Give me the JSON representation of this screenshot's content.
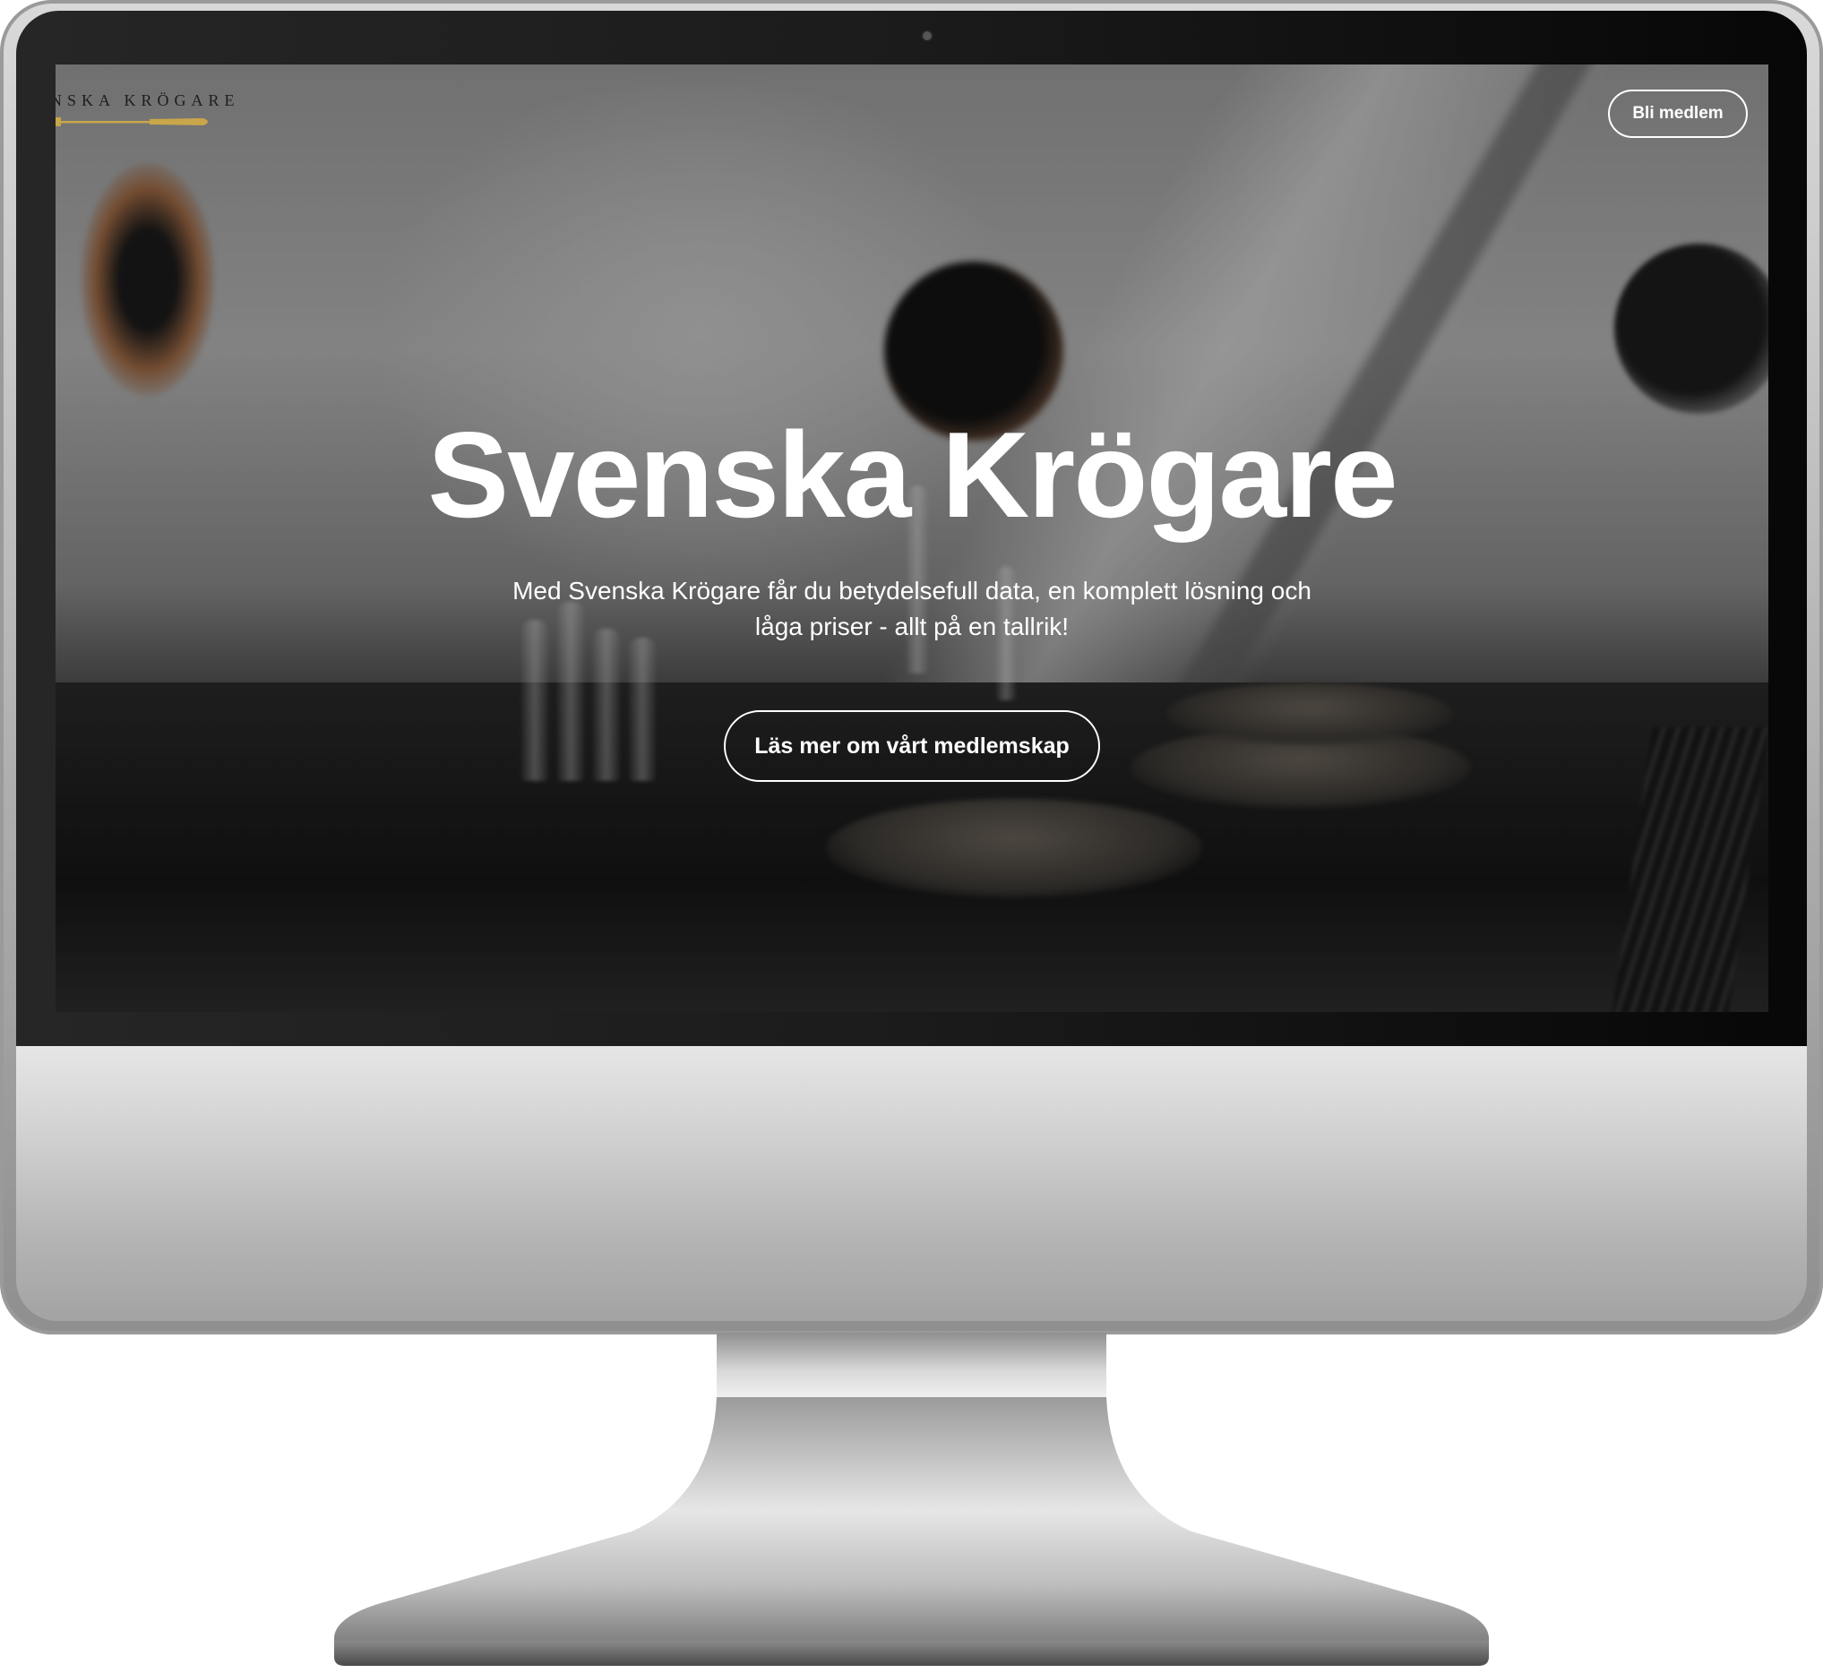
{
  "site": {
    "logo_text": "NSKA KRÖGARE",
    "logo_icon": "knife-icon",
    "header": {
      "member_button_label": "Bli medlem"
    },
    "hero": {
      "title": "Svenska Krögare",
      "subtitle": "Med Svenska Krögare får du betydelsefull data, en komplett lösning och låga priser - allt på en tallrik!",
      "cta_label": "Läs mer om vårt medlemskap"
    }
  },
  "colors": {
    "text_on_hero": "#ffffff",
    "logo_gold": "#c9a64a",
    "logo_text": "#1d1d1d",
    "bezel": "#1b1b1b",
    "monitor_silver": "#c4c4c4"
  }
}
